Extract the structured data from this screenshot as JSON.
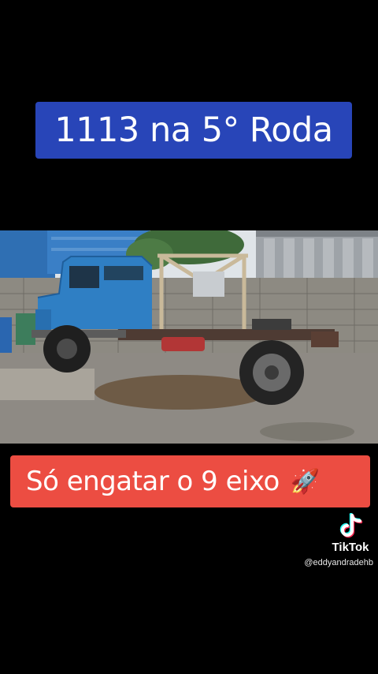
{
  "top_caption": {
    "text": "1113 na 5° Roda",
    "bg": "#2845b8"
  },
  "bottom_caption": {
    "text": "Só engatar o 9 eixo",
    "emoji": "🚀",
    "bg": "#ec4d42"
  },
  "photo": {
    "subject": "blue truck cab with chassis and fifth wheel, parked in a yard"
  },
  "watermark": {
    "brand": "TikTok",
    "handle": "@eddyandradehb",
    "icon": "tiktok-note-icon"
  },
  "colors": {
    "background": "#000000",
    "truck_blue": "#2f7fc4",
    "text": "#ffffff"
  }
}
